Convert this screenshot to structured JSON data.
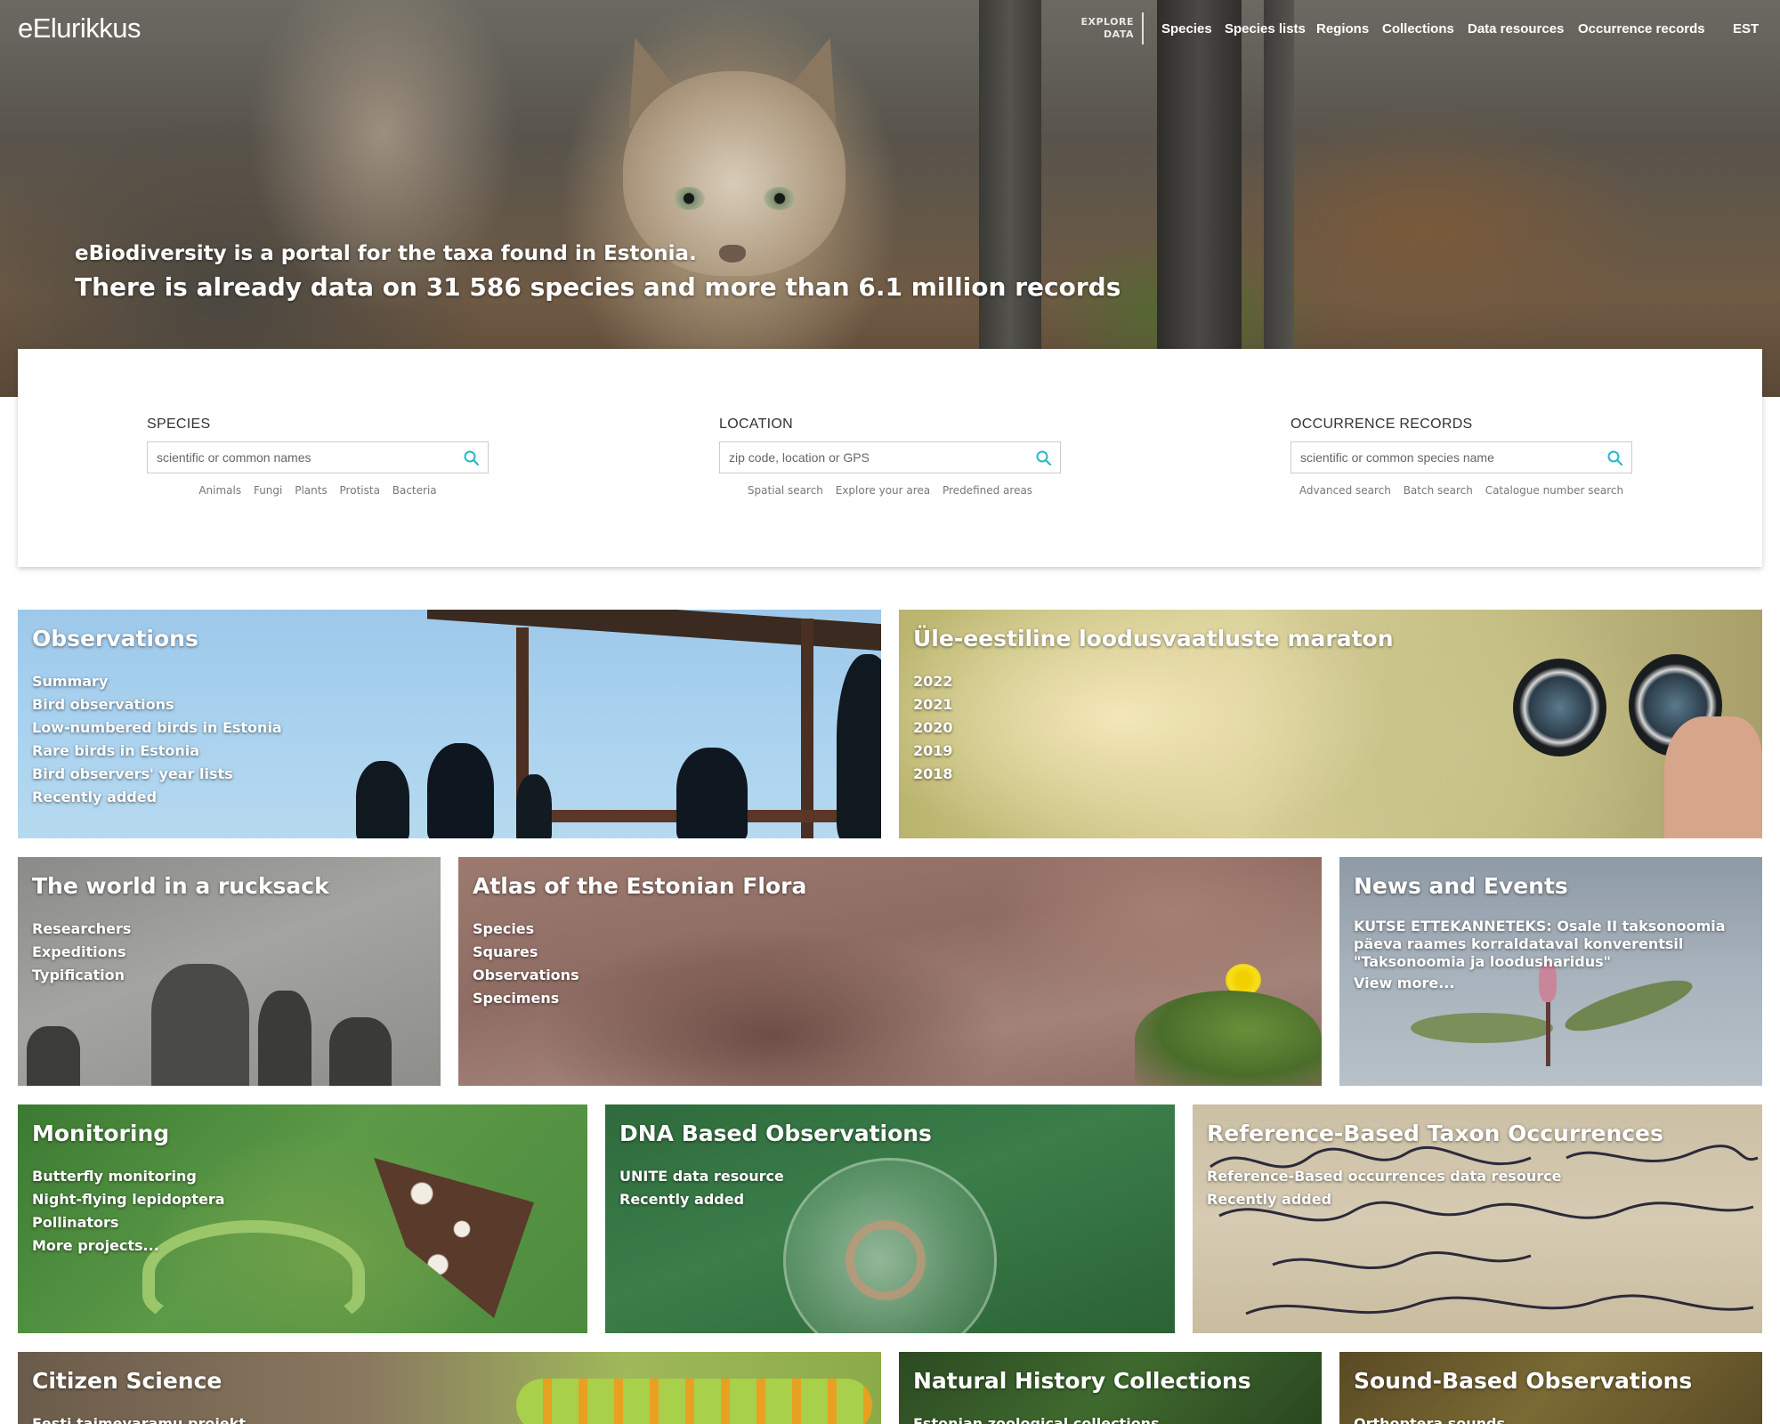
{
  "header": {
    "logo": "eElurikkus",
    "explore_line1": "EXPLORE",
    "explore_line2": "DATA",
    "nav": [
      "Species",
      "Species lists",
      "Regions",
      "Collections",
      "Data resources",
      "Occurrence records",
      "EST"
    ]
  },
  "hero": {
    "line1": "eBiodiversity is a portal for the taxa found in Estonia.",
    "line2": "There is already data on 31 586 species and more than 6.1 million records"
  },
  "search": {
    "species": {
      "title": "SPECIES",
      "placeholder": "scientific or common names",
      "links": [
        "Animals",
        "Fungi",
        "Plants",
        "Protista",
        "Bacteria"
      ]
    },
    "location": {
      "title": "LOCATION",
      "placeholder": "zip code, location or GPS",
      "links": [
        "Spatial search",
        "Explore your area",
        "Predefined areas"
      ]
    },
    "occurrence": {
      "title": "OCCURRENCE RECORDS",
      "placeholder": "scientific or common species name",
      "links": [
        "Advanced search",
        "Batch search",
        "Catalogue number search"
      ]
    },
    "icon": "search-icon",
    "accent_color": "#2bb6c9"
  },
  "tiles": {
    "observations": {
      "title": "Observations",
      "links": [
        "Summary",
        "Bird observations",
        "Low-numbered birds in Estonia",
        "Rare birds in Estonia",
        "Bird observers' year lists",
        "Recently added"
      ]
    },
    "marathon": {
      "title": "Üle-eestiline loodusvaatluste maraton",
      "links": [
        "2022",
        "2021",
        "2020",
        "2019",
        "2018"
      ]
    },
    "rucksack": {
      "title": "The world in a rucksack",
      "links": [
        "Researchers",
        "Expeditions",
        "Typification"
      ]
    },
    "atlas": {
      "title": "Atlas of the Estonian Flora",
      "links": [
        "Species",
        "Squares",
        "Observations",
        "Specimens"
      ]
    },
    "news": {
      "title": "News and Events",
      "text": "KUTSE ETTEKANNETEKS: Osale II taksonoomia päeva raames korraldataval konverentsil \"Taksonoomia ja loodusharidus\"",
      "more": "View more..."
    },
    "monitoring": {
      "title": "Monitoring",
      "links": [
        "Butterfly monitoring",
        "Night-flying lepidoptera",
        "Pollinators",
        "More projects..."
      ]
    },
    "dna": {
      "title": "DNA Based Observations",
      "links": [
        "UNITE data resource",
        "Recently added"
      ]
    },
    "reference": {
      "title": "Reference-Based Taxon Occurrences",
      "links": [
        "Reference-Based occurrences data resource",
        "Recently added"
      ]
    },
    "citizen": {
      "title": "Citizen Science",
      "links": [
        "Eesti taimevaramu projekt"
      ]
    },
    "natural": {
      "title": "Natural History Collections",
      "links": [
        "Estonian zoological collections"
      ]
    },
    "sound": {
      "title": "Sound-Based Observations",
      "links": [
        "Orthoptera sounds"
      ]
    }
  }
}
